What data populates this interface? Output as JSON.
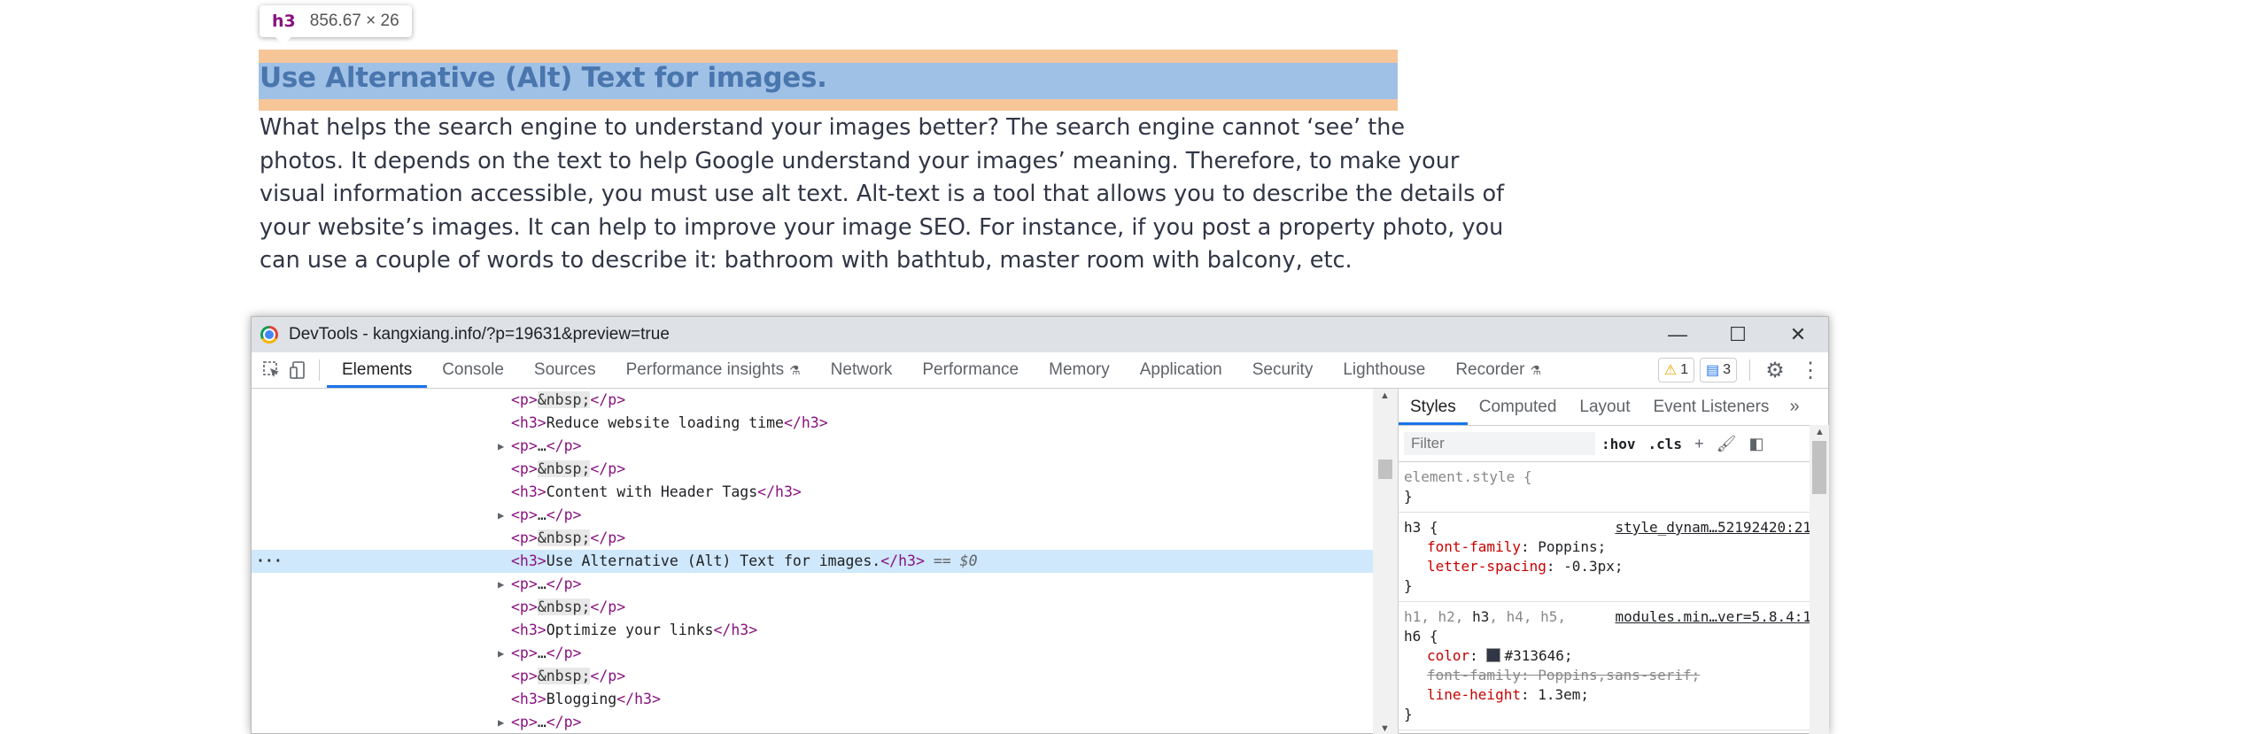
{
  "tooltip": {
    "tag": "h3",
    "size": "856.67 × 26"
  },
  "page": {
    "heading": "Use Alternative (Alt) Text for images.",
    "paragraph_lines": [
      "What helps the search engine to understand your images better? The search engine cannot ‘see’ the",
      "photos. It depends on the text to help Google understand your images’ meaning. Therefore, to make your",
      "visual information accessible, you must use alt text. Alt-text is a tool that allows you to describe the details of",
      "your website’s images. It can help to improve your image SEO. For instance, if you post a property photo, you",
      "can use a couple of words to describe it: bathroom with bathtub, master room with balcony, etc."
    ]
  },
  "devtools": {
    "window_title": "DevTools - kangxiang.info/?p=19631&preview=true",
    "window_buttons": {
      "minimize": "—",
      "maximize": "☐",
      "close": "✕"
    },
    "tabs": {
      "elements": "Elements",
      "console": "Console",
      "sources": "Sources",
      "performance_insights": "Performance insights",
      "network": "Network",
      "performance": "Performance",
      "memory": "Memory",
      "application": "Application",
      "security": "Security",
      "lighthouse": "Lighthouse",
      "recorder": "Recorder"
    },
    "badges": {
      "warnings": "1",
      "messages": "3"
    },
    "dom_lines": [
      {
        "open": "<p>",
        "content": "&nbsp;",
        "close": "</p>",
        "kind": "nbsp"
      },
      {
        "open": "<h3>",
        "content": "Reduce website loading time",
        "close": "</h3>",
        "kind": "text"
      },
      {
        "open": "<p>",
        "content": "…",
        "close": "</p>",
        "kind": "collapsed"
      },
      {
        "open": "<p>",
        "content": "&nbsp;",
        "close": "</p>",
        "kind": "nbsp"
      },
      {
        "open": "<h3>",
        "content": "Content with Header Tags",
        "close": "</h3>",
        "kind": "text"
      },
      {
        "open": "<p>",
        "content": "…",
        "close": "</p>",
        "kind": "collapsed"
      },
      {
        "open": "<p>",
        "content": "&nbsp;",
        "close": "</p>",
        "kind": "nbsp"
      },
      {
        "open": "<h3>",
        "content": "Use Alternative (Alt) Text for images.",
        "close": "</h3>",
        "kind": "selected",
        "suffix": " == $0"
      },
      {
        "open": "<p>",
        "content": "…",
        "close": "</p>",
        "kind": "collapsed"
      },
      {
        "open": "<p>",
        "content": "&nbsp;",
        "close": "</p>",
        "kind": "nbsp"
      },
      {
        "open": "<h3>",
        "content": "Optimize your links",
        "close": "</h3>",
        "kind": "text"
      },
      {
        "open": "<p>",
        "content": "…",
        "close": "</p>",
        "kind": "collapsed"
      },
      {
        "open": "<p>",
        "content": "&nbsp;",
        "close": "</p>",
        "kind": "nbsp"
      },
      {
        "open": "<h3>",
        "content": "Blogging",
        "close": "</h3>",
        "kind": "text"
      },
      {
        "open": "<p>",
        "content": "…",
        "close": "</p>",
        "kind": "collapsed"
      }
    ],
    "styles": {
      "tabs": {
        "styles": "Styles",
        "computed": "Computed",
        "layout": "Layout",
        "event_listeners": "Event Listeners"
      },
      "filter_placeholder": "Filter",
      "hov": ":hov",
      "cls": ".cls",
      "element_style": {
        "selector": "element.style {",
        "close": "}"
      },
      "h3_rule": {
        "selector": "h3 {",
        "source": "style_dynam…52192420:21",
        "prop1_name": "font-family",
        "prop1_value": " Poppins;",
        "prop2_name": "letter-spacing",
        "prop2_value": " -0.3px;",
        "close": "}"
      },
      "headings_rule": {
        "selector_line1_pre": "h1, h2, ",
        "selector_line1_h3": "h3",
        "selector_line1_post": ", h4, h5,",
        "selector_line2": "h6 {",
        "source": "modules.min…ver=5.8.4:1",
        "color_name": "color",
        "color_value": "#313646;",
        "swatch_color": "#313646",
        "ff_name": "font-family",
        "ff_value": " Poppins,sans-serif;",
        "lh_name": "line-height",
        "lh_value": " 1.3em;",
        "close": "}"
      }
    }
  }
}
